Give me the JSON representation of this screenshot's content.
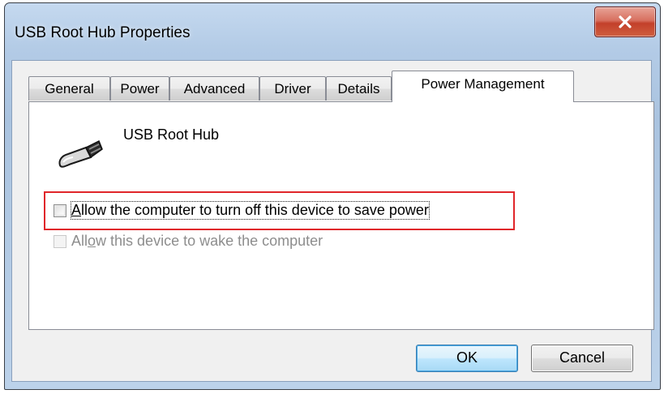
{
  "window": {
    "title": "USB Root Hub Properties",
    "close_glyph": "x"
  },
  "tabs": [
    {
      "label": "General",
      "active": false
    },
    {
      "label": "Power",
      "active": false
    },
    {
      "label": "Advanced",
      "active": false
    },
    {
      "label": "Driver",
      "active": false
    },
    {
      "label": "Details",
      "active": false
    },
    {
      "label": "Power Management",
      "active": true
    }
  ],
  "device": {
    "name": "USB Root Hub",
    "icon": "usb-plug-icon"
  },
  "options": [
    {
      "label_parts": [
        "",
        "A",
        "llow the computer to turn off this device to save power"
      ],
      "checked": false,
      "enabled": true,
      "highlighted": true
    },
    {
      "label_parts": [
        "All",
        "o",
        "w this device to wake the computer"
      ],
      "checked": false,
      "enabled": false,
      "highlighted": false
    }
  ],
  "buttons": {
    "ok_label": "OK",
    "cancel_label": "Cancel"
  },
  "colors": {
    "highlight_border": "#e0262a",
    "close_button": "#c3402a",
    "default_button_border": "#3c7fb1"
  }
}
